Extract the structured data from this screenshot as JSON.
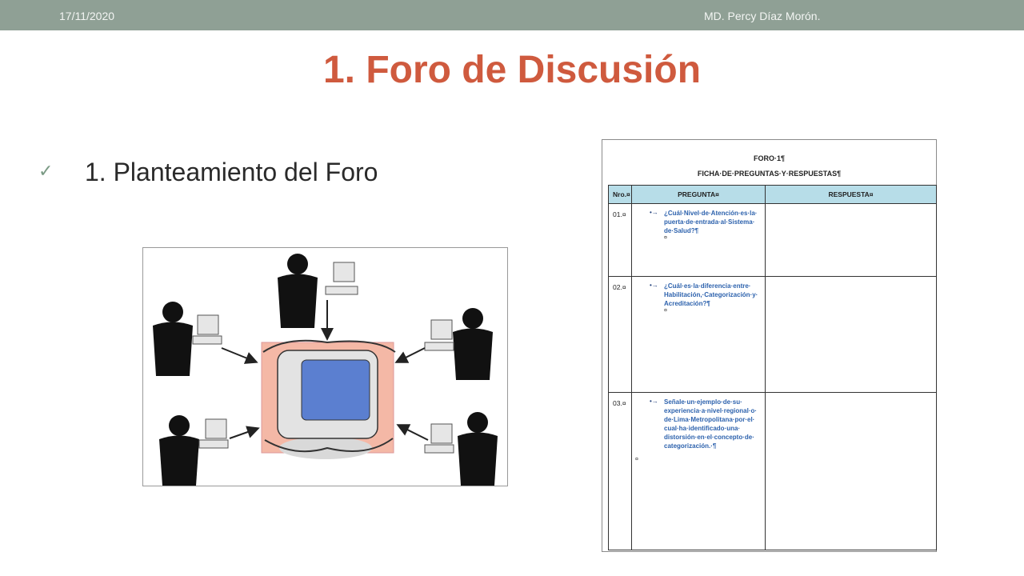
{
  "header": {
    "date": "17/11/2020",
    "author": "MD. Percy Díaz Morón."
  },
  "slide": {
    "title": "1. Foro de Discusión",
    "bullet_icon": "checkmark-icon",
    "bullet_text": "1. Planteamiento  del Foro"
  },
  "form": {
    "title": "FORO·1¶",
    "subtitle": "FICHA·DE·PREGUNTAS·Y·RESPUESTAS¶",
    "columns": [
      "Nro.¤",
      "PREGUNTA¤",
      "RESPUESTA¤"
    ],
    "rows": [
      {
        "num": "01.¤",
        "question": "¿Cuál·Nivel·de·Atención·es·la· puerta·de·entrada·al·Sistema· de·Salud?¶"
      },
      {
        "num": "02.¤",
        "question": "¿Cuál·es·la·diferencia·entre· Habilitación,·Categorización·y· Acreditación?¶"
      },
      {
        "num": "03.¤",
        "question": "Señale·un·ejemplo·de·su· experiencia·a·nivel·regional·o· de·Lima·Metropolitana·por·el· cual·ha·identificado·una· distorsión·en·el·concepto·de· categorización.·¶"
      }
    ],
    "bullet_glyph": "•→",
    "cell_mark": "¤"
  },
  "colors": {
    "topbar": "#8fa095",
    "title": "#cf5a3e",
    "table_header": "#b7dde8",
    "question_text": "#2d62ad"
  }
}
